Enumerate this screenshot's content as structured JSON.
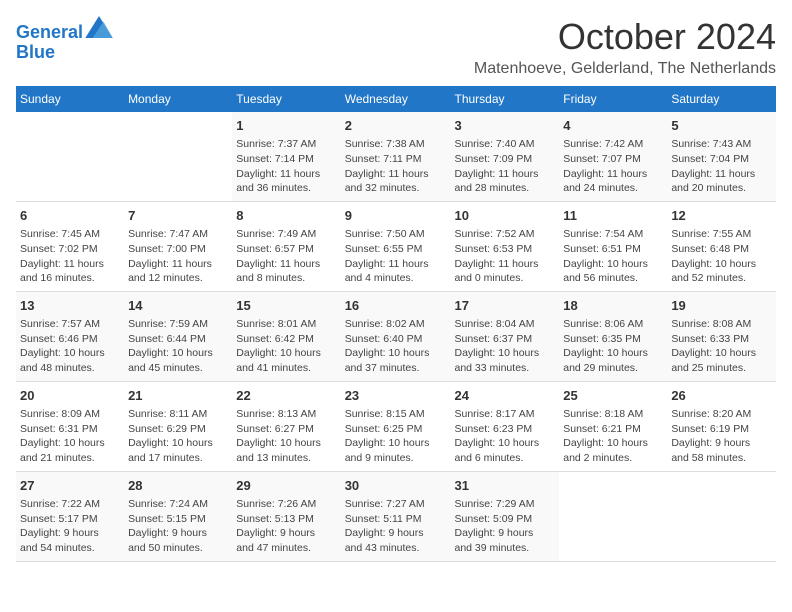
{
  "header": {
    "logo_line1": "General",
    "logo_line2": "Blue",
    "month": "October 2024",
    "location": "Matenhoeve, Gelderland, The Netherlands"
  },
  "days_of_week": [
    "Sunday",
    "Monday",
    "Tuesday",
    "Wednesday",
    "Thursday",
    "Friday",
    "Saturday"
  ],
  "weeks": [
    [
      {
        "day": "",
        "info": ""
      },
      {
        "day": "",
        "info": ""
      },
      {
        "day": "1",
        "info": "Sunrise: 7:37 AM\nSunset: 7:14 PM\nDaylight: 11 hours\nand 36 minutes."
      },
      {
        "day": "2",
        "info": "Sunrise: 7:38 AM\nSunset: 7:11 PM\nDaylight: 11 hours\nand 32 minutes."
      },
      {
        "day": "3",
        "info": "Sunrise: 7:40 AM\nSunset: 7:09 PM\nDaylight: 11 hours\nand 28 minutes."
      },
      {
        "day": "4",
        "info": "Sunrise: 7:42 AM\nSunset: 7:07 PM\nDaylight: 11 hours\nand 24 minutes."
      },
      {
        "day": "5",
        "info": "Sunrise: 7:43 AM\nSunset: 7:04 PM\nDaylight: 11 hours\nand 20 minutes."
      }
    ],
    [
      {
        "day": "6",
        "info": "Sunrise: 7:45 AM\nSunset: 7:02 PM\nDaylight: 11 hours\nand 16 minutes."
      },
      {
        "day": "7",
        "info": "Sunrise: 7:47 AM\nSunset: 7:00 PM\nDaylight: 11 hours\nand 12 minutes."
      },
      {
        "day": "8",
        "info": "Sunrise: 7:49 AM\nSunset: 6:57 PM\nDaylight: 11 hours\nand 8 minutes."
      },
      {
        "day": "9",
        "info": "Sunrise: 7:50 AM\nSunset: 6:55 PM\nDaylight: 11 hours\nand 4 minutes."
      },
      {
        "day": "10",
        "info": "Sunrise: 7:52 AM\nSunset: 6:53 PM\nDaylight: 11 hours\nand 0 minutes."
      },
      {
        "day": "11",
        "info": "Sunrise: 7:54 AM\nSunset: 6:51 PM\nDaylight: 10 hours\nand 56 minutes."
      },
      {
        "day": "12",
        "info": "Sunrise: 7:55 AM\nSunset: 6:48 PM\nDaylight: 10 hours\nand 52 minutes."
      }
    ],
    [
      {
        "day": "13",
        "info": "Sunrise: 7:57 AM\nSunset: 6:46 PM\nDaylight: 10 hours\nand 48 minutes."
      },
      {
        "day": "14",
        "info": "Sunrise: 7:59 AM\nSunset: 6:44 PM\nDaylight: 10 hours\nand 45 minutes."
      },
      {
        "day": "15",
        "info": "Sunrise: 8:01 AM\nSunset: 6:42 PM\nDaylight: 10 hours\nand 41 minutes."
      },
      {
        "day": "16",
        "info": "Sunrise: 8:02 AM\nSunset: 6:40 PM\nDaylight: 10 hours\nand 37 minutes."
      },
      {
        "day": "17",
        "info": "Sunrise: 8:04 AM\nSunset: 6:37 PM\nDaylight: 10 hours\nand 33 minutes."
      },
      {
        "day": "18",
        "info": "Sunrise: 8:06 AM\nSunset: 6:35 PM\nDaylight: 10 hours\nand 29 minutes."
      },
      {
        "day": "19",
        "info": "Sunrise: 8:08 AM\nSunset: 6:33 PM\nDaylight: 10 hours\nand 25 minutes."
      }
    ],
    [
      {
        "day": "20",
        "info": "Sunrise: 8:09 AM\nSunset: 6:31 PM\nDaylight: 10 hours\nand 21 minutes."
      },
      {
        "day": "21",
        "info": "Sunrise: 8:11 AM\nSunset: 6:29 PM\nDaylight: 10 hours\nand 17 minutes."
      },
      {
        "day": "22",
        "info": "Sunrise: 8:13 AM\nSunset: 6:27 PM\nDaylight: 10 hours\nand 13 minutes."
      },
      {
        "day": "23",
        "info": "Sunrise: 8:15 AM\nSunset: 6:25 PM\nDaylight: 10 hours\nand 9 minutes."
      },
      {
        "day": "24",
        "info": "Sunrise: 8:17 AM\nSunset: 6:23 PM\nDaylight: 10 hours\nand 6 minutes."
      },
      {
        "day": "25",
        "info": "Sunrise: 8:18 AM\nSunset: 6:21 PM\nDaylight: 10 hours\nand 2 minutes."
      },
      {
        "day": "26",
        "info": "Sunrise: 8:20 AM\nSunset: 6:19 PM\nDaylight: 9 hours\nand 58 minutes."
      }
    ],
    [
      {
        "day": "27",
        "info": "Sunrise: 7:22 AM\nSunset: 5:17 PM\nDaylight: 9 hours\nand 54 minutes."
      },
      {
        "day": "28",
        "info": "Sunrise: 7:24 AM\nSunset: 5:15 PM\nDaylight: 9 hours\nand 50 minutes."
      },
      {
        "day": "29",
        "info": "Sunrise: 7:26 AM\nSunset: 5:13 PM\nDaylight: 9 hours\nand 47 minutes."
      },
      {
        "day": "30",
        "info": "Sunrise: 7:27 AM\nSunset: 5:11 PM\nDaylight: 9 hours\nand 43 minutes."
      },
      {
        "day": "31",
        "info": "Sunrise: 7:29 AM\nSunset: 5:09 PM\nDaylight: 9 hours\nand 39 minutes."
      },
      {
        "day": "",
        "info": ""
      },
      {
        "day": "",
        "info": ""
      }
    ]
  ]
}
